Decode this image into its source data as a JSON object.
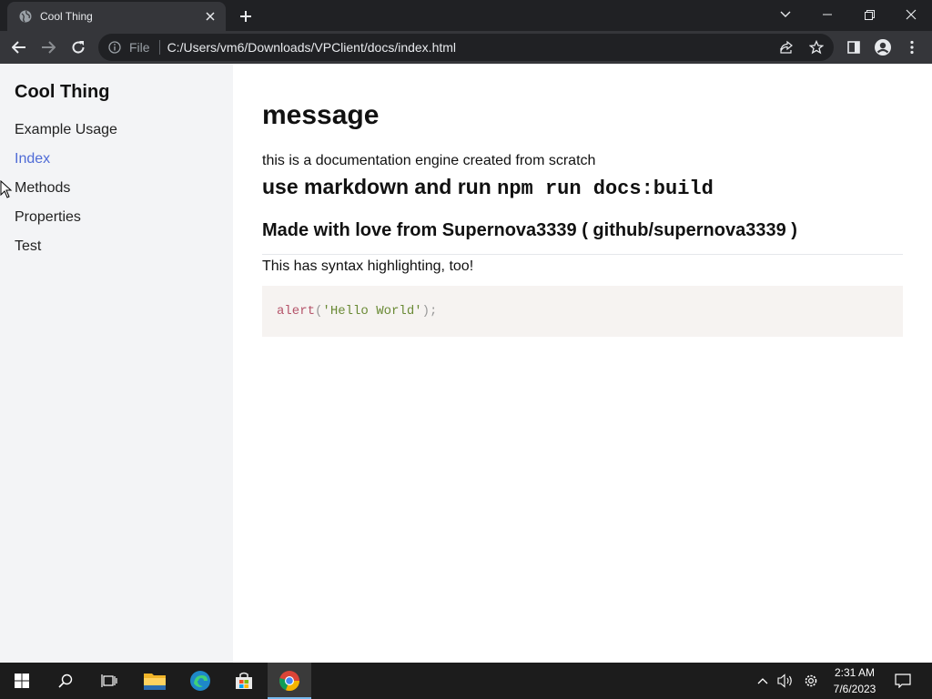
{
  "browser": {
    "tab": {
      "title": "Cool Thing",
      "favicon": "globe-icon"
    },
    "omnibox": {
      "scheme": "File",
      "url": "C:/Users/vm6/Downloads/VPClient/docs/index.html"
    }
  },
  "sidebar": {
    "title": "Cool Thing",
    "items": [
      {
        "label": "Example Usage",
        "active": false
      },
      {
        "label": "Index",
        "active": true
      },
      {
        "label": "Methods",
        "active": false
      },
      {
        "label": "Properties",
        "active": false
      },
      {
        "label": "Test",
        "active": false
      }
    ],
    "active_color": "#4f6bd6"
  },
  "content": {
    "heading": "message",
    "intro": "this is a documentation engine created from scratch",
    "subheading_text": "use markdown and run ",
    "subheading_code": "npm run docs:build",
    "credits": "Made with love from Supernova3339 ( github/supernova3339 )",
    "syntax_note": "This has syntax highlighting, too!",
    "code": {
      "fn": "alert",
      "open": "(",
      "string": "'Hello World'",
      "close": ");"
    }
  },
  "taskbar": {
    "time": "2:31 AM",
    "date": "7/6/2023",
    "apps": [
      "start-icon",
      "search-icon",
      "task-view-icon",
      "file-explorer-icon",
      "edge-icon",
      "store-icon",
      "chrome-icon"
    ]
  }
}
